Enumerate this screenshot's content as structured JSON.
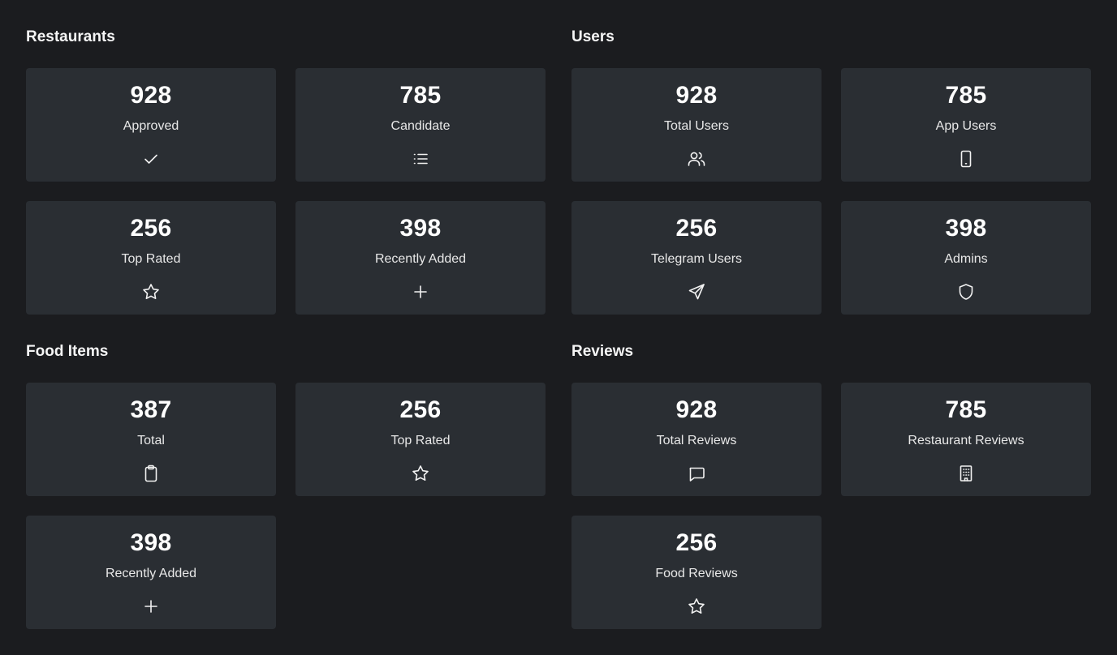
{
  "restaurants": {
    "title": "Restaurants",
    "cards": [
      {
        "value": "928",
        "label": "Approved",
        "icon": "check-icon"
      },
      {
        "value": "785",
        "label": "Candidate",
        "icon": "list-icon"
      },
      {
        "value": "256",
        "label": "Top Rated",
        "icon": "star-icon"
      },
      {
        "value": "398",
        "label": "Recently Added",
        "icon": "plus-icon"
      }
    ]
  },
  "users": {
    "title": "Users",
    "cards": [
      {
        "value": "928",
        "label": "Total Users",
        "icon": "users-icon"
      },
      {
        "value": "785",
        "label": "App Users",
        "icon": "smartphone-icon"
      },
      {
        "value": "256",
        "label": "Telegram Users",
        "icon": "send-icon"
      },
      {
        "value": "398",
        "label": "Admins",
        "icon": "shield-icon"
      }
    ]
  },
  "food_items": {
    "title": "Food Items",
    "cards": [
      {
        "value": "387",
        "label": "Total",
        "icon": "clipboard-icon"
      },
      {
        "value": "256",
        "label": "Top Rated",
        "icon": "star-icon"
      },
      {
        "value": "398",
        "label": "Recently Added",
        "icon": "plus-icon"
      }
    ]
  },
  "reviews": {
    "title": "Reviews",
    "cards": [
      {
        "value": "928",
        "label": "Total Reviews",
        "icon": "message-icon"
      },
      {
        "value": "785",
        "label": "Restaurant Reviews",
        "icon": "building-icon"
      },
      {
        "value": "256",
        "label": "Food Reviews",
        "icon": "star-icon"
      }
    ]
  }
}
